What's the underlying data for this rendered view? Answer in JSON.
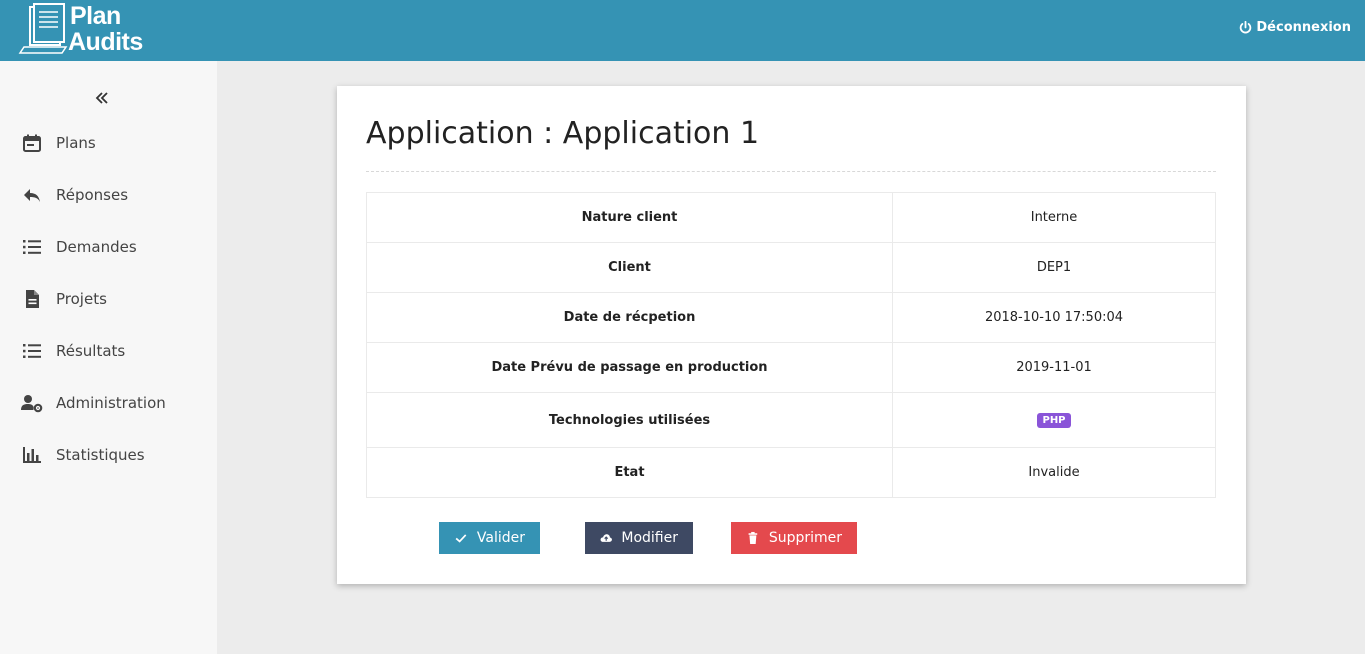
{
  "header": {
    "logo_line1": "Plan",
    "logo_line2": "Audits",
    "logout_label": "Déconnexion",
    "logout_icon": "power-icon",
    "background": "#3593b4"
  },
  "sidebar": {
    "collapse_icon": "double-chevron-left-icon",
    "items": [
      {
        "label": "Plans",
        "icon": "calendar-icon"
      },
      {
        "label": "Réponses",
        "icon": "reply-icon"
      },
      {
        "label": "Demandes",
        "icon": "list-icon"
      },
      {
        "label": "Projets",
        "icon": "document-icon"
      },
      {
        "label": "Résultats",
        "icon": "list-icon"
      },
      {
        "label": "Administration",
        "icon": "user-cog-icon"
      },
      {
        "label": "Statistiques",
        "icon": "bar-chart-icon"
      }
    ]
  },
  "card": {
    "title": "Application : Application 1",
    "rows": [
      {
        "key": "Nature client",
        "value": "Interne"
      },
      {
        "key": "Client",
        "value": "DEP1"
      },
      {
        "key": "Date de récpetion",
        "value": "2018-10-10 17:50:04"
      },
      {
        "key": "Date Prévu de passage en production",
        "value": "2019-11-01"
      },
      {
        "key": "Technologies utilisées",
        "value": "PHP"
      },
      {
        "key": "Etat",
        "value": "Invalide"
      }
    ],
    "buttons": {
      "validate": {
        "label": "Valider",
        "icon": "check-icon",
        "color": "#3593b4"
      },
      "edit": {
        "label": "Modifier",
        "icon": "cloud-upload-icon",
        "color": "#3e4963"
      },
      "delete": {
        "label": "Supprimer",
        "icon": "trash-icon",
        "color": "#e4494d"
      }
    },
    "badge_color": "#8a54d8"
  }
}
